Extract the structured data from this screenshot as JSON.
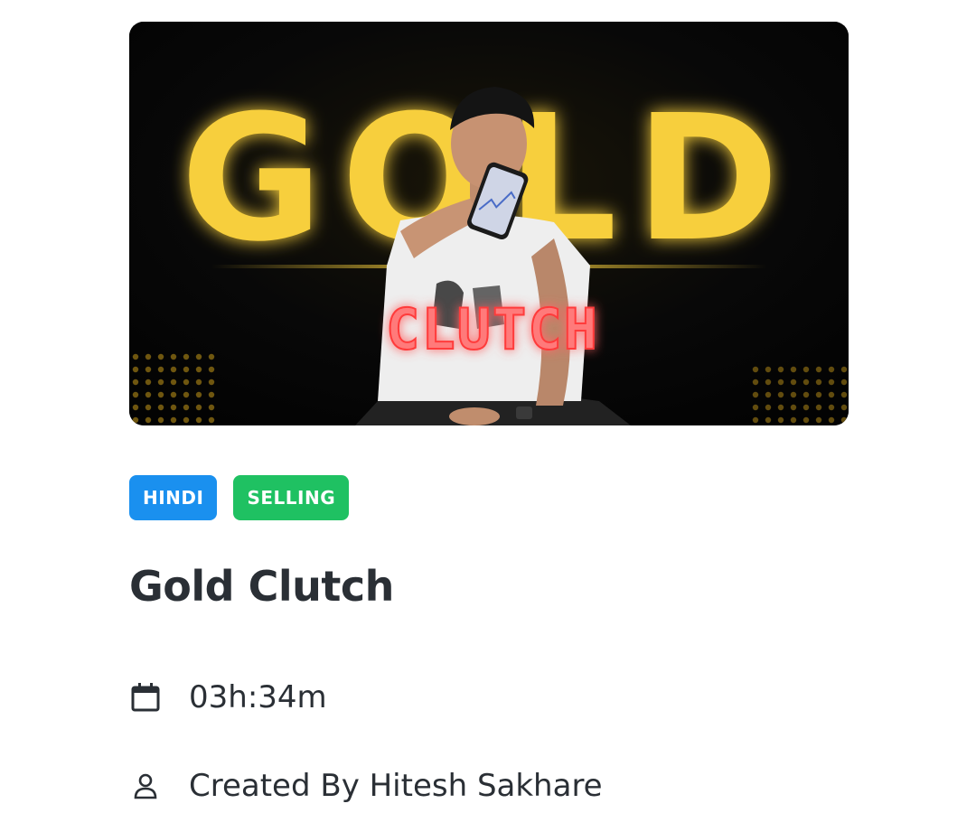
{
  "thumbnail": {
    "title_text": "GOLD",
    "subtitle_text": "CLUTCH",
    "colors": {
      "background": "#070707",
      "gold": "#f7cf3c",
      "neon_red": "#ff6b6b"
    }
  },
  "badges": [
    {
      "label": "HINDI",
      "color": "#1a90ef"
    },
    {
      "label": "SELLING",
      "color": "#1fc162"
    }
  ],
  "course": {
    "title": "Gold Clutch",
    "duration": "03h:34m",
    "creator": "Created By Hitesh Sakhare"
  },
  "icons": {
    "duration": "calendar-icon",
    "creator": "user-icon"
  }
}
